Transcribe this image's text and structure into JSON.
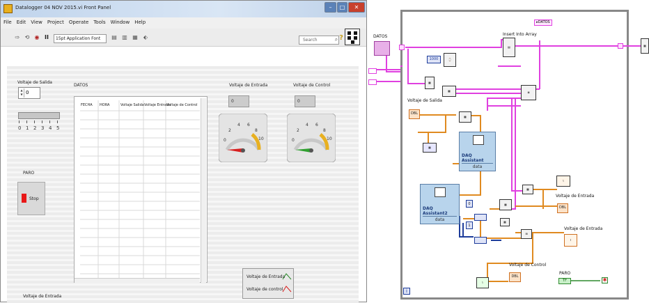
{
  "front_panel": {
    "title": "Datalogger 04 NOV 2015.vi Front Panel",
    "menu": [
      "File",
      "Edit",
      "View",
      "Project",
      "Operate",
      "Tools",
      "Window",
      "Help"
    ],
    "font_selector": "15pt Application Font",
    "search_placeholder": "Search",
    "voltaje_salida_label": "Voltaje de Salida",
    "voltaje_salida_value": "0",
    "slider_value_fraction": 0.0,
    "slider_ticks": [
      "0",
      "1",
      "2",
      "3",
      "4",
      "5"
    ],
    "paro_label": "PARO",
    "stop_label": "Stop",
    "datos_label": "DATOS",
    "table_headers": [
      "FECHA",
      "HORA",
      "Voltaje Salida",
      "Voltaje Entrada",
      "Voltaje de Control"
    ],
    "voltaje_entrada_label": "Voltaje de Entrada",
    "voltaje_entrada_value": "0",
    "voltaje_control_label": "Voltaje de Control",
    "voltaje_control_value": "0",
    "gauge_ticks": [
      "0",
      "2",
      "4",
      "6",
      "8",
      "10"
    ],
    "gauge_value": 0,
    "legend_entries": [
      "Voltaje de Entrada",
      "Voltaje de control"
    ],
    "bottom_label": "Voltaje de Entrada",
    "colors": {
      "needle_entrada": "#d82020",
      "needle_control": "#30a030",
      "gauge_arc": "#e8b020"
    }
  },
  "block_diagram": {
    "datos_label": "DATOS",
    "datos_ref": "▸DATOS",
    "constant_1000": "1000",
    "insert_into_array": "Insert Into Array",
    "voltaje_salida_label": "Voltaje de Salida",
    "voltaje_salida_term": "DBL",
    "daq1_title": "DAQ Assistant",
    "daq1_data": "data",
    "daq2_title": "DAQ Assistant2",
    "daq2_data": "data",
    "voltaje_entrada_1": "Voltaje de Entrada",
    "voltaje_entrada_1_term": "DBL",
    "voltaje_entrada_2": "Voltaje de Entrada",
    "voltaje_control": "Voltaje de Control",
    "voltaje_control_term": "DBL",
    "paro": "PARO",
    "paro_term": "TF",
    "index_0": "0",
    "index_1": "1",
    "loop_iter": "i",
    "colors": {
      "wire_string": "#e040e0",
      "wire_dbl": "#e08a20",
      "wire_int": "#1d3c9a",
      "wire_bool": "#2e8a2e"
    }
  }
}
